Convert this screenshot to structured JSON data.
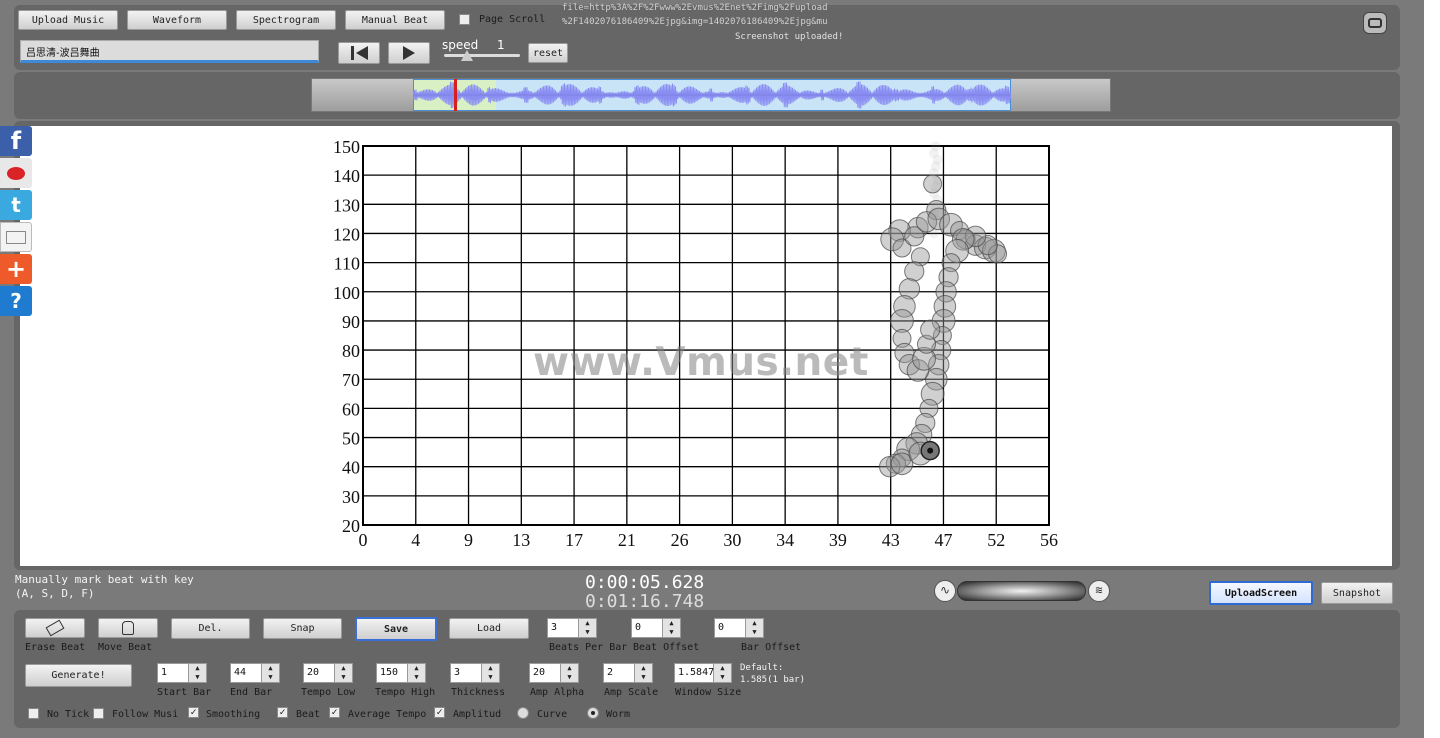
{
  "toolbar": {
    "upload_music": "Upload Music",
    "waveform": "Waveform",
    "spectrogram": "Spectrogram",
    "manual_beat": "Manual Beat",
    "page_scroll": "Page Scroll"
  },
  "song_title": "吕思清-波吕舞曲",
  "speed": {
    "label": "speed",
    "value": "1",
    "level": 0.25
  },
  "reset_label": "reset",
  "upload_info": {
    "line1": "file=http%3A%2F%2Fwww%2Evmus%2Enet%2Fimg%2Fupload",
    "line2": "%2F1402076186409%2Ejpg&img=1402076186409%2Ejpg&mu",
    "status": "Screenshot uploaded!"
  },
  "watermark": "www.Vmus.net",
  "chart_data": {
    "type": "scatter",
    "x_ticks": [
      "0",
      "4",
      "9",
      "13",
      "17",
      "21",
      "26",
      "30",
      "34",
      "39",
      "43",
      "47",
      "52",
      "56"
    ],
    "y_ticks": [
      "150",
      "140",
      "130",
      "120",
      "110",
      "100",
      "90",
      "80",
      "70",
      "60",
      "50",
      "40",
      "30",
      "20"
    ],
    "xlim": [
      0,
      56
    ],
    "ylim": [
      20,
      150
    ],
    "grid": true,
    "trail": [
      [
        46.5,
        137
      ],
      [
        46.8,
        128
      ],
      [
        45.3,
        122
      ],
      [
        43.8,
        121
      ],
      [
        43.2,
        118
      ],
      [
        44.0,
        115
      ],
      [
        45.0,
        119
      ],
      [
        46.0,
        124
      ],
      [
        47.0,
        125
      ],
      [
        48.0,
        123
      ],
      [
        48.7,
        121
      ],
      [
        49.2,
        118
      ],
      [
        50.0,
        116
      ],
      [
        50.8,
        115
      ],
      [
        51.5,
        114
      ],
      [
        51.8,
        113
      ],
      [
        51.0,
        116
      ],
      [
        50.0,
        119
      ],
      [
        49.0,
        118
      ],
      [
        48.5,
        114
      ],
      [
        48.0,
        110
      ],
      [
        47.8,
        105
      ],
      [
        47.6,
        100
      ],
      [
        47.5,
        95
      ],
      [
        47.4,
        90
      ],
      [
        47.3,
        85
      ],
      [
        47.2,
        80
      ],
      [
        47.0,
        75
      ],
      [
        46.8,
        70
      ],
      [
        46.5,
        65
      ],
      [
        46.2,
        60
      ],
      [
        45.9,
        55
      ],
      [
        45.6,
        51
      ],
      [
        45.2,
        48
      ],
      [
        44.5,
        46
      ],
      [
        44.0,
        43
      ],
      [
        43.5,
        41
      ],
      [
        43.0,
        40
      ],
      [
        44.0,
        41
      ],
      [
        45.5,
        44.5
      ],
      [
        45.5,
        112
      ],
      [
        45.0,
        107
      ],
      [
        44.6,
        101
      ],
      [
        44.2,
        95
      ],
      [
        44.0,
        90
      ],
      [
        44.0,
        84
      ],
      [
        44.2,
        79
      ],
      [
        44.6,
        75
      ],
      [
        45.3,
        73
      ],
      [
        45.8,
        77
      ],
      [
        46.0,
        82
      ],
      [
        46.3,
        87
      ]
    ],
    "current_point": [
      46.3,
      45.5
    ]
  },
  "instruction": {
    "line1": "Manually mark beat with key",
    "line2": "(A, S, D, F)"
  },
  "time": {
    "current": "0:00:05.628",
    "total": "0:01:16.748"
  },
  "actions": {
    "upload_screen": "UploadScreen",
    "snapshot": "Snapshot"
  },
  "beat_tools": {
    "erase": "Erase Beat",
    "move": "Move Beat",
    "del": "Del.",
    "snap": "Snap",
    "save": "Save",
    "load": "Load",
    "generate": "Generate!"
  },
  "params": {
    "beats_per_bar": {
      "label": "Beats Per Bar",
      "value": "3"
    },
    "beat_offset": {
      "label": "Beat Offset",
      "value": "0"
    },
    "bar_offset": {
      "label": "Bar Offset",
      "value": "0"
    },
    "start_bar": {
      "label": "Start Bar",
      "value": "1"
    },
    "end_bar": {
      "label": "End Bar",
      "value": "44"
    },
    "tempo_low": {
      "label": "Tempo Low",
      "value": "20"
    },
    "tempo_high": {
      "label": "Tempo High",
      "value": "150"
    },
    "thickness": {
      "label": "Thickness",
      "value": "3"
    },
    "amp_alpha": {
      "label": "Amp Alpha",
      "value": "20"
    },
    "amp_scale": {
      "label": "Amp Scale",
      "value": "2"
    },
    "window_size": {
      "label": "Window Size",
      "value": "1.5847"
    },
    "default_note": {
      "line1": "Default:",
      "line2": "1.585(1 bar)"
    }
  },
  "options": {
    "no_tick": "No Tick",
    "follow_music": "Follow Musi",
    "smoothing": "Smoothing",
    "beat": "Beat",
    "average_tempo": "Average Tempo",
    "amplitude": "Amplitud",
    "curve": "Curve",
    "worm": "Worm"
  },
  "social_icons": [
    "facebook-icon",
    "weibo-icon",
    "twitter-icon",
    "mail-icon",
    "plus-icon",
    "help-icon"
  ],
  "colors": {
    "waveform": "#8a8ef2",
    "overview_bg": "#c9e3f7",
    "selection": "#d8f0c4",
    "playhead": "#d71f1f"
  }
}
